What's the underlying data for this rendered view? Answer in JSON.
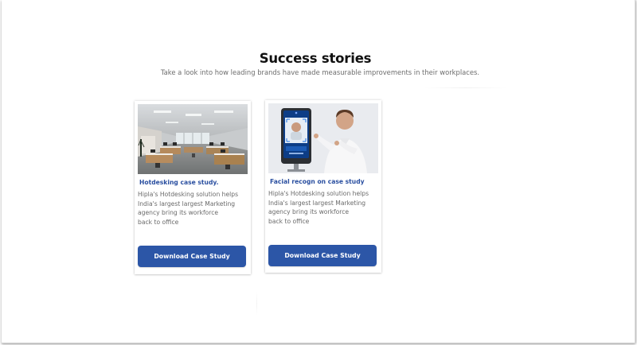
{
  "section": {
    "title": "Success stories",
    "subtitle": "Take a look into how leading brands have made measurable improvements in their workplaces."
  },
  "cards": [
    {
      "image_icon": "office-photo",
      "title": "Hotdesking case study.",
      "description": "Hipla's Hotdesking solution helps\nIndia's largest largest Marketing\nagency bring its workforce\nback to office",
      "button_label": "Download Case Study"
    },
    {
      "image_icon": "facial-recognition-kiosk-photo",
      "title": "Facial recogn on case study",
      "description": "Hipla's Hotdesking solution helps\nIndia's largest largest Marketing\nagency bring its workforce\nback to office",
      "button_label": "Download Case Study"
    }
  ],
  "colors": {
    "accent": "#2c56a7",
    "card_title": "#2a4fa0",
    "heading": "#111111",
    "body_text": "#6a6a6a"
  }
}
